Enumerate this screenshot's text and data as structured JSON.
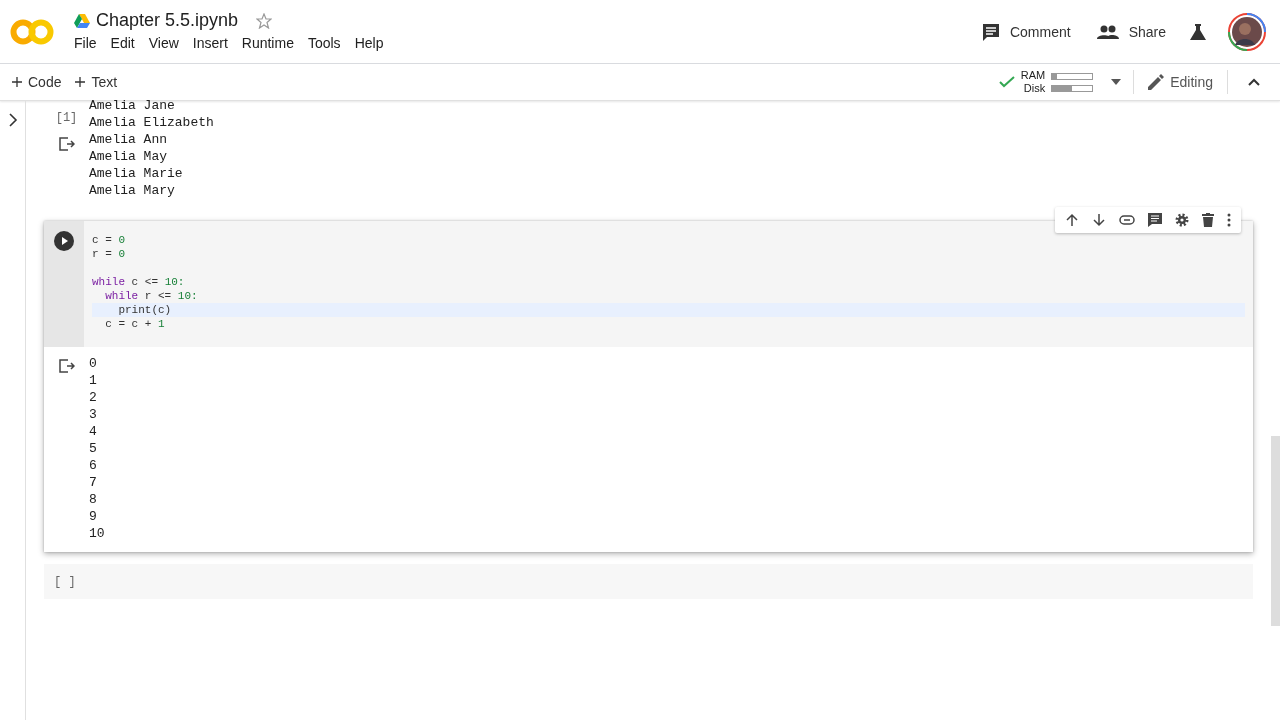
{
  "header": {
    "title": "Chapter 5.5.ipynb",
    "starred": false,
    "menu": [
      "File",
      "Edit",
      "View",
      "Insert",
      "Runtime",
      "Tools",
      "Help"
    ],
    "actions": [
      {
        "kind": "comment",
        "label": "Comment"
      },
      {
        "kind": "share",
        "label": "Share"
      }
    ]
  },
  "toolbar": {
    "add": [
      {
        "label": "Code"
      },
      {
        "label": "Text"
      }
    ],
    "resources": {
      "connected": true,
      "ram": {
        "label": "RAM",
        "level": 0.12
      },
      "disk": {
        "label": "Disk",
        "level": 0.5
      }
    },
    "mode": "Editing"
  },
  "cells": [
    {
      "kind": "output",
      "count": "[1]",
      "output": [
        "Amelia Jane",
        "Amelia Elizabeth",
        "Amelia Ann",
        "Amelia May",
        "Amelia Marie",
        "Amelia Mary"
      ]
    },
    {
      "kind": "code",
      "focused": true,
      "code": [
        {
          "kind": "code",
          "active": false,
          "tokens": [
            {
              "t": "c = ",
              "kind": "plain"
            },
            {
              "t": "0",
              "kind": "number"
            }
          ]
        },
        {
          "kind": "code",
          "active": false,
          "tokens": [
            {
              "t": "r = ",
              "kind": "plain"
            },
            {
              "t": "0",
              "kind": "number"
            }
          ]
        },
        {
          "kind": "blank",
          "active": false
        },
        {
          "kind": "code",
          "active": false,
          "tokens": [
            {
              "t": "while",
              "kind": "keyword"
            },
            {
              "t": " c <= ",
              "kind": "plain"
            },
            {
              "t": "10:",
              "kind": "number"
            }
          ]
        },
        {
          "kind": "code",
          "active": false,
          "tokens": [
            {
              "t": "  while",
              "kind": "keyword"
            },
            {
              "t": " r <= ",
              "kind": "plain"
            },
            {
              "t": "10:",
              "kind": "number"
            }
          ]
        },
        {
          "kind": "code",
          "active": true,
          "tokens": [
            {
              "t": "    print(c)",
              "kind": "plain"
            }
          ]
        },
        {
          "kind": "code",
          "active": false,
          "tokens": [
            {
              "t": "  c = c + ",
              "kind": "plain"
            },
            {
              "t": "1",
              "kind": "number"
            }
          ]
        }
      ],
      "output": [
        "0",
        "1",
        "2",
        "3",
        "4",
        "5",
        "6",
        "7",
        "8",
        "9",
        "10"
      ]
    },
    {
      "kind": "empty",
      "count": "[ ]"
    }
  ]
}
